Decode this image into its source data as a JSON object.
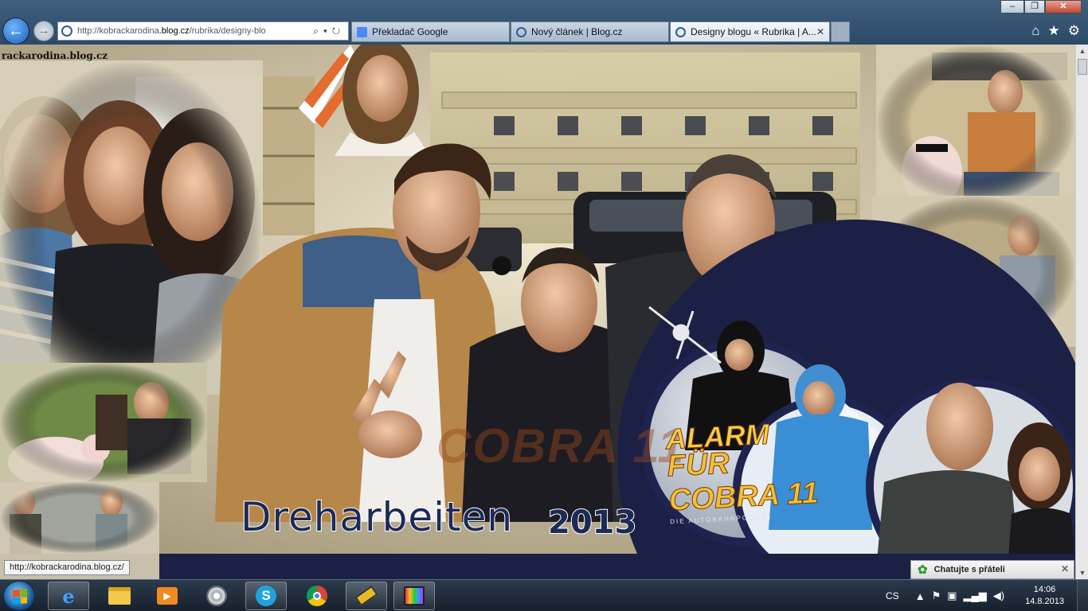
{
  "browser": {
    "back_label": "←",
    "forward_label": "→",
    "address": {
      "prefix": "http://",
      "host_pre": "kobrackarodina",
      "host_bold": ".blog.cz",
      "path": "/rubrika/designy-blo"
    },
    "tabs": [
      {
        "label": "Překladač Google",
        "active": false
      },
      {
        "label": "Nový článek | Blog.cz",
        "active": false
      },
      {
        "label": "Designy blogu « Rubrika | A...",
        "active": true
      }
    ],
    "tab_close": "✕",
    "toolbar_icons": [
      "home-icon",
      "favorites-star-icon",
      "tools-gear-icon"
    ],
    "window_buttons": {
      "minimize": "–",
      "maximize": "❐",
      "close": "✕"
    }
  },
  "page": {
    "blog_url_text": "rackarodina.blog.cz",
    "banner_title": "Dreharbeiten",
    "banner_year": "2013",
    "watermark": "COBRA 11",
    "logo": {
      "line1": "ALARM",
      "line2": "FÜR COBRA 11",
      "line3": "DIE AUTOBAHNPOLIZEI"
    }
  },
  "status_tooltip": "http://kobrackarodina.blog.cz/",
  "chat": {
    "label": "Chatujte s přáteli",
    "close": "✕"
  },
  "taskbar": {
    "apps": [
      "start-button",
      "internet-explorer",
      "windows-explorer",
      "media-player",
      "webcam-app",
      "skype",
      "chrome",
      "video-editor",
      "image-viewer"
    ],
    "tray": {
      "language": "CS",
      "time": "14:06",
      "date": "14.8.2013"
    }
  },
  "colors": {
    "titlebar": "#2c4a68",
    "banner_navy": "#1c2044",
    "title_text": "#1c2a56"
  }
}
